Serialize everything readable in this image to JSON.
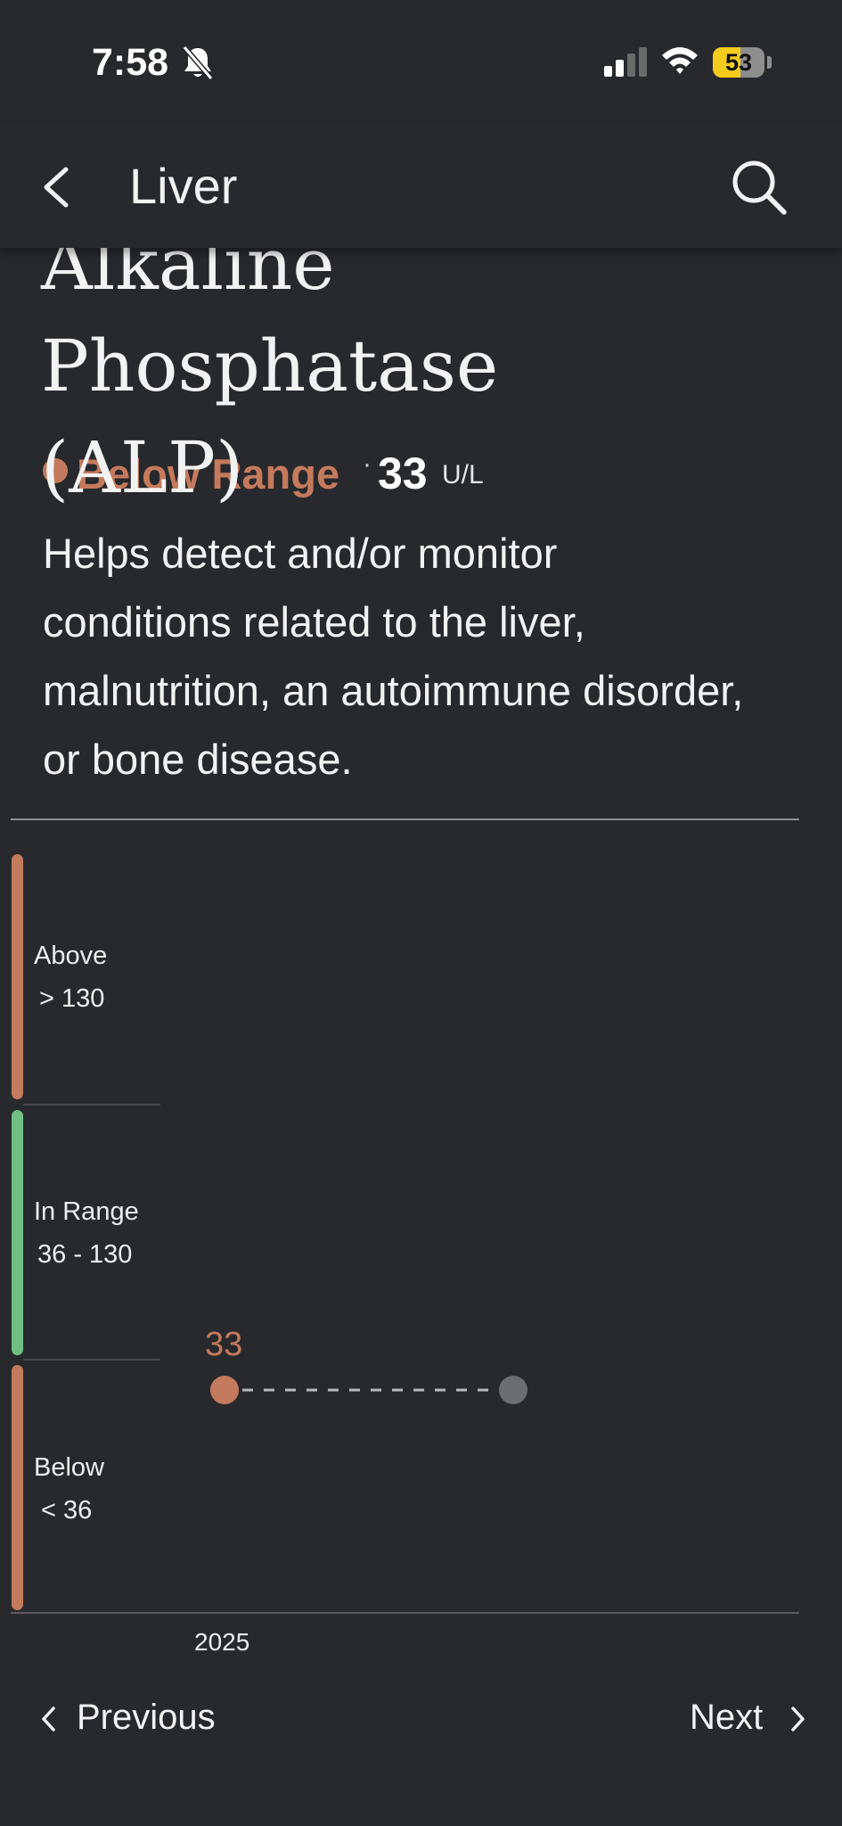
{
  "status_bar": {
    "time": "7:58",
    "battery_level": "53",
    "battery_percent": 53,
    "icons": [
      "bell-slash-icon",
      "cellular-signal-icon",
      "wifi-icon",
      "battery-icon"
    ]
  },
  "header": {
    "title": "Liver",
    "back_icon": "chevron-left-icon",
    "search_icon": "search-icon"
  },
  "test": {
    "name_line1": "Alkaline Phosphatase",
    "name_line2": "(ALP)",
    "status": "Below Range",
    "separator": "·",
    "value": "33",
    "unit": "U/L",
    "description": "Helps detect and/or monitor conditions related to the liver, malnutrition, an autoimmune disorder, or bone disease."
  },
  "colors": {
    "background": "#28292d",
    "below": "#c47a5c",
    "above": "#c47a5c",
    "in_range": "#6fbf83",
    "future_point": "#6b6d70"
  },
  "chart_data": {
    "type": "scatter",
    "ranges": [
      {
        "name": "Above",
        "label": "> 130",
        "color": "#c47a5c"
      },
      {
        "name": "In Range",
        "label": "36 - 130",
        "color": "#6fbf83"
      },
      {
        "name": "Below",
        "label": "< 36",
        "color": "#c47a5c"
      }
    ],
    "points": [
      {
        "x": "2025",
        "y": 33,
        "label": "33",
        "band": "Below"
      }
    ],
    "x_labels": [
      "2025"
    ],
    "connector": "dashed"
  },
  "footer": {
    "previous_label": "Previous",
    "next_label": "Next"
  }
}
